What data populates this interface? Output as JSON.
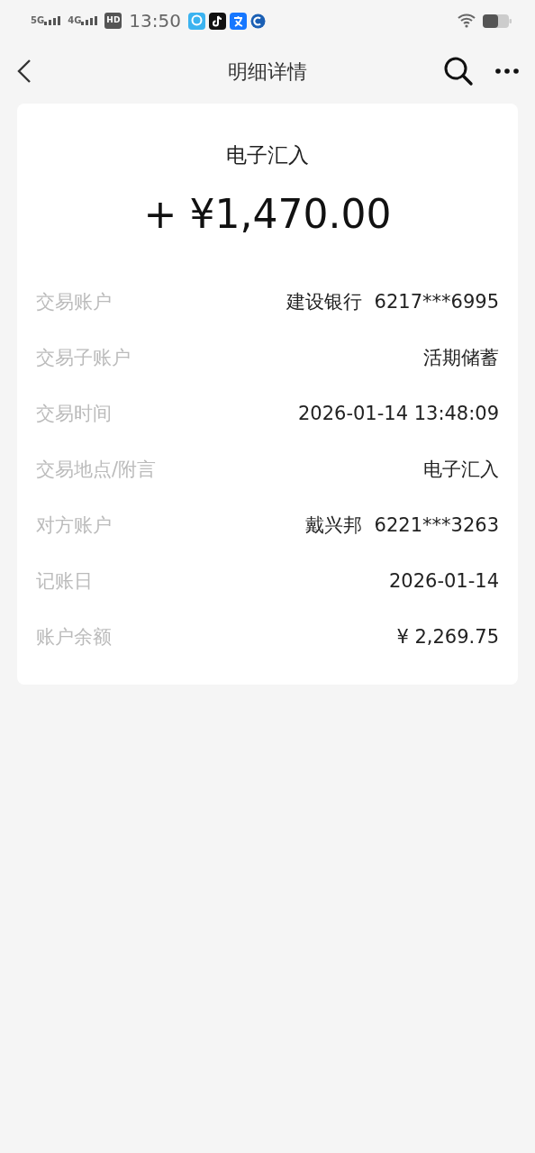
{
  "status_bar": {
    "network_1": "5G",
    "network_2": "4G",
    "hd": "HD",
    "time": "13:50"
  },
  "header": {
    "title": "明细详情"
  },
  "card": {
    "type": "电子汇入",
    "amount": "+ ¥1,470.00",
    "rows": [
      {
        "label": "交易账户",
        "value": "建设银行  6217***6995"
      },
      {
        "label": "交易子账户",
        "value": "活期储蓄"
      },
      {
        "label": "交易时间",
        "value": "2026-01-14 13:48:09"
      },
      {
        "label": "交易地点/附言",
        "value": "电子汇入"
      },
      {
        "label": "对方账户",
        "value": "戴兴邦  6221***3263"
      },
      {
        "label": "记账日",
        "value": "2026-01-14"
      },
      {
        "label": "账户余额",
        "value": "¥ 2,269.75"
      }
    ]
  }
}
